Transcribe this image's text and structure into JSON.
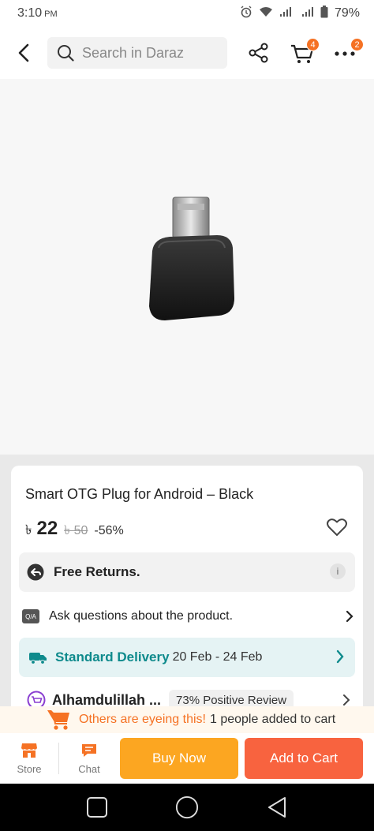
{
  "status_bar": {
    "time": "3:10",
    "ampm": "PM",
    "battery": "79%"
  },
  "header": {
    "search_placeholder": "Search in Daraz",
    "cart_count": "4",
    "more_count": "2"
  },
  "product": {
    "title": "Smart OTG Plug for Android – Black",
    "currency": "৳",
    "price": "22",
    "original_price": "৳ 50",
    "discount": "-56%"
  },
  "returns": {
    "label": "Free Returns.",
    "info_icon": "i"
  },
  "qa": {
    "badge": "Q/A",
    "label": "Ask questions about the product."
  },
  "delivery": {
    "label": "Standard Delivery",
    "dates": "20 Feb - 24 Feb"
  },
  "seller": {
    "name": "Alhamdulillah ...",
    "review": "73% Positive Review"
  },
  "eyeing": {
    "highlight": "Others are eyeing this!",
    "rest": "1 people added to cart"
  },
  "bottom_bar": {
    "store_label": "Store",
    "chat_label": "Chat",
    "buy_now_label": "Buy Now",
    "add_to_cart_label": "Add to Cart"
  },
  "colors": {
    "brand_orange": "#f57224",
    "buy_now": "#fca621",
    "add_to_cart": "#f8633f",
    "delivery_teal": "#0e8a8c"
  }
}
